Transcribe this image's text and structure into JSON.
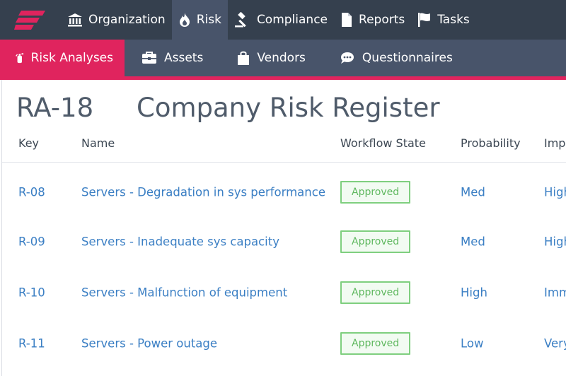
{
  "topnav": {
    "items": [
      {
        "label": "Organization",
        "icon": "bank-icon"
      },
      {
        "label": "Risk",
        "icon": "flame-icon"
      },
      {
        "label": "Compliance",
        "icon": "gavel-icon"
      },
      {
        "label": "Reports",
        "icon": "document-icon"
      },
      {
        "label": "Tasks",
        "icon": "flag-icon"
      }
    ],
    "active": "Risk"
  },
  "subnav": {
    "items": [
      {
        "label": "Risk Analyses",
        "icon": "fire-extinguisher-icon"
      },
      {
        "label": "Assets",
        "icon": "briefcase-icon"
      },
      {
        "label": "Vendors",
        "icon": "shopping-bag-icon"
      },
      {
        "label": "Questionnaires",
        "icon": "chat-icon"
      }
    ],
    "active": "Risk Analyses"
  },
  "page": {
    "key": "RA-18",
    "title": "Company Risk Register"
  },
  "table": {
    "headers": [
      "Key",
      "Name",
      "Workflow State",
      "Probability",
      "Imp"
    ],
    "rows": [
      {
        "key": "R-08",
        "name": "Servers - Degradation in sys performance",
        "state": "Approved",
        "probability": "Med",
        "impact": "High"
      },
      {
        "key": "R-09",
        "name": "Servers - Inadequate sys capacity",
        "state": "Approved",
        "probability": "Med",
        "impact": "High"
      },
      {
        "key": "R-10",
        "name": "Servers - Malfunction of equipment",
        "state": "Approved",
        "probability": "High",
        "impact": "Imm"
      },
      {
        "key": "R-11",
        "name": "Servers - Power outage",
        "state": "Approved",
        "probability": "Low",
        "impact": "Very"
      }
    ]
  },
  "colors": {
    "topbar": "#35404e",
    "subbar": "#48546a",
    "accent": "#e0245e",
    "link": "#3b7fc4",
    "approved": "#5fb85f"
  }
}
